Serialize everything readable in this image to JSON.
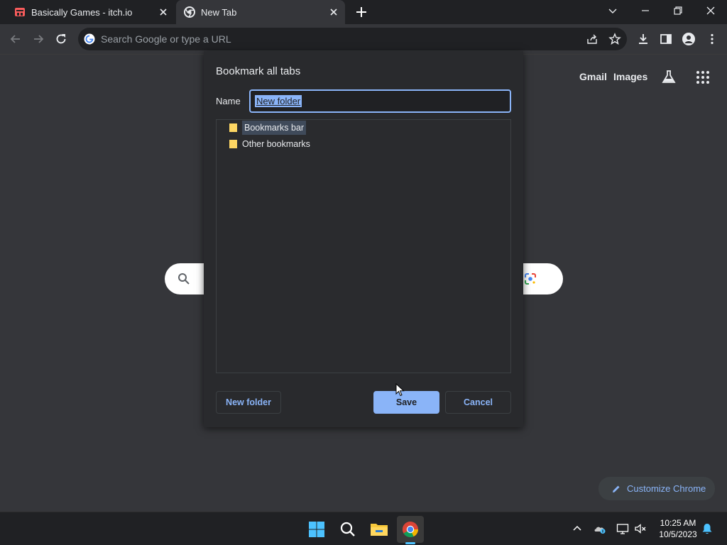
{
  "tabs": [
    {
      "title": "Basically Games - itch.io",
      "icon": "itchio-icon",
      "active": false
    },
    {
      "title": "New Tab",
      "icon": "chrome-icon",
      "active": true
    }
  ],
  "omnibox": {
    "placeholder": "Search Google or type a URL"
  },
  "ntp": {
    "gmail": "Gmail",
    "images": "Images",
    "customize": "Customize Chrome"
  },
  "dialog": {
    "title": "Bookmark all tabs",
    "name_label": "Name",
    "name_value": "New folder",
    "folders": [
      "Bookmarks bar",
      "Other bookmarks"
    ],
    "new_folder_label": "New folder",
    "save_label": "Save",
    "cancel_label": "Cancel"
  },
  "taskbar": {
    "apps": [
      "windows-start-icon",
      "search-icon",
      "file-explorer-icon",
      "chrome-icon"
    ],
    "time": "10:25 AM",
    "date": "10/5/2023"
  },
  "colors": {
    "accent": "#8ab4f8",
    "bg": "#35363a",
    "dialog_bg": "#292a2d",
    "tabstrip": "#202124"
  }
}
